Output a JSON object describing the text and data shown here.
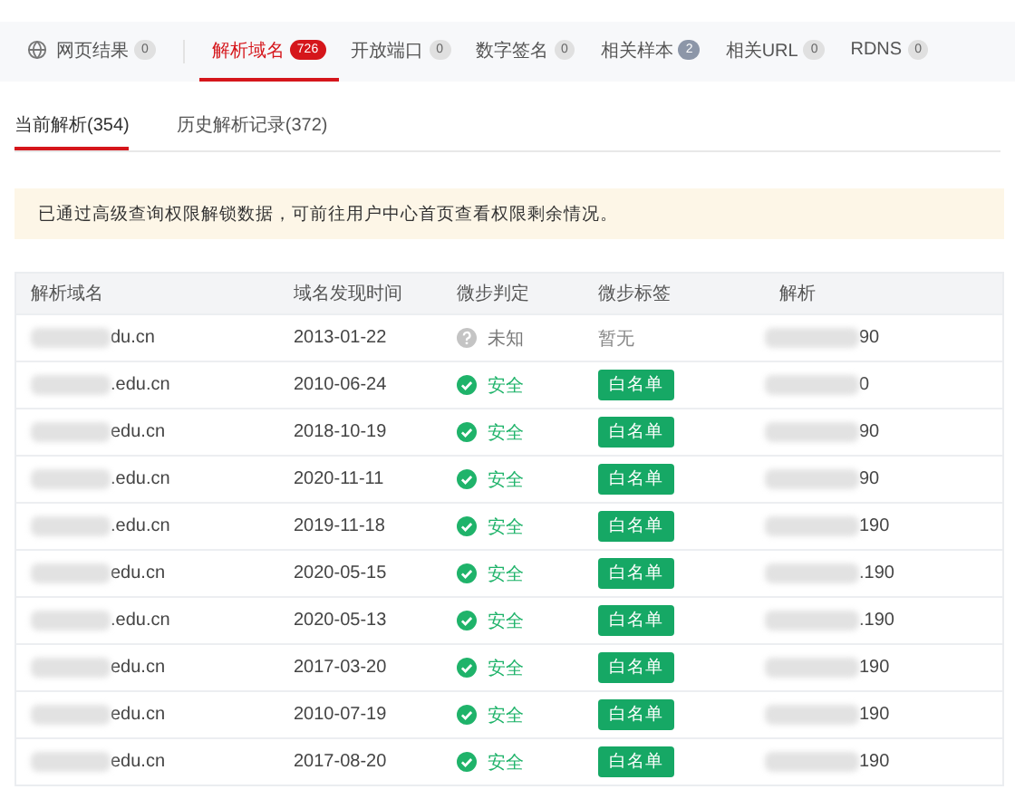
{
  "tabs": [
    {
      "label": "网页结果",
      "count": "0",
      "selected": false,
      "kind": "icon"
    },
    {
      "label": "解析域名",
      "count": "726",
      "selected": true,
      "kind": "plain"
    },
    {
      "label": "开放端口",
      "count": "0",
      "selected": false,
      "kind": "plain"
    },
    {
      "label": "数字签名",
      "count": "0",
      "selected": false,
      "kind": "plain"
    },
    {
      "label": "相关样本",
      "count": "2",
      "selected": false,
      "kind": "plain"
    },
    {
      "label": "相关URL",
      "count": "0",
      "selected": false,
      "kind": "plain"
    },
    {
      "label": "RDNS",
      "count": "0",
      "selected": false,
      "kind": "plain"
    }
  ],
  "subtabs": [
    {
      "label": "当前解析(354)",
      "selected": true
    },
    {
      "label": "历史解析记录(372)",
      "selected": false
    }
  ],
  "notice": "已通过高级查询权限解锁数据，可前往用户中心首页查看权限剩余情况。",
  "table": {
    "columns": [
      "解析域名",
      "域名发现时间",
      "微步判定",
      "微步标签",
      "解析"
    ],
    "rows": [
      {
        "domain": "du.cn",
        "date": "2013-01-22",
        "verdict": {
          "kind": "unknown",
          "text": "未知"
        },
        "tag": {
          "kind": "none",
          "text": "暂无"
        },
        "ip": "90"
      },
      {
        "domain": ".edu.cn",
        "date": "2010-06-24",
        "verdict": {
          "kind": "safe",
          "text": "安全"
        },
        "tag": {
          "kind": "whitelist",
          "text": "白名单"
        },
        "ip": "0"
      },
      {
        "domain": "edu.cn",
        "date": "2018-10-19",
        "verdict": {
          "kind": "safe",
          "text": "安全"
        },
        "tag": {
          "kind": "whitelist",
          "text": "白名单"
        },
        "ip": "90"
      },
      {
        "domain": ".edu.cn",
        "date": "2020-11-11",
        "verdict": {
          "kind": "safe",
          "text": "安全"
        },
        "tag": {
          "kind": "whitelist",
          "text": "白名单"
        },
        "ip": "90"
      },
      {
        "domain": ".edu.cn",
        "date": "2019-11-18",
        "verdict": {
          "kind": "safe",
          "text": "安全"
        },
        "tag": {
          "kind": "whitelist",
          "text": "白名单"
        },
        "ip": "190"
      },
      {
        "domain": "edu.cn",
        "date": "2020-05-15",
        "verdict": {
          "kind": "safe",
          "text": "安全"
        },
        "tag": {
          "kind": "whitelist",
          "text": "白名单"
        },
        "ip": ".190"
      },
      {
        "domain": ".edu.cn",
        "date": "2020-05-13",
        "verdict": {
          "kind": "safe",
          "text": "安全"
        },
        "tag": {
          "kind": "whitelist",
          "text": "白名单"
        },
        "ip": ".190"
      },
      {
        "domain": "edu.cn",
        "date": "2017-03-20",
        "verdict": {
          "kind": "safe",
          "text": "安全"
        },
        "tag": {
          "kind": "whitelist",
          "text": "白名单"
        },
        "ip": "190"
      },
      {
        "domain": "edu.cn",
        "date": "2010-07-19",
        "verdict": {
          "kind": "safe",
          "text": "安全"
        },
        "tag": {
          "kind": "whitelist",
          "text": "白名单"
        },
        "ip": "190"
      },
      {
        "domain": "edu.cn",
        "date": "2017-08-20",
        "verdict": {
          "kind": "safe",
          "text": "安全"
        },
        "tag": {
          "kind": "whitelist",
          "text": "白名单"
        },
        "ip": "190"
      }
    ]
  }
}
